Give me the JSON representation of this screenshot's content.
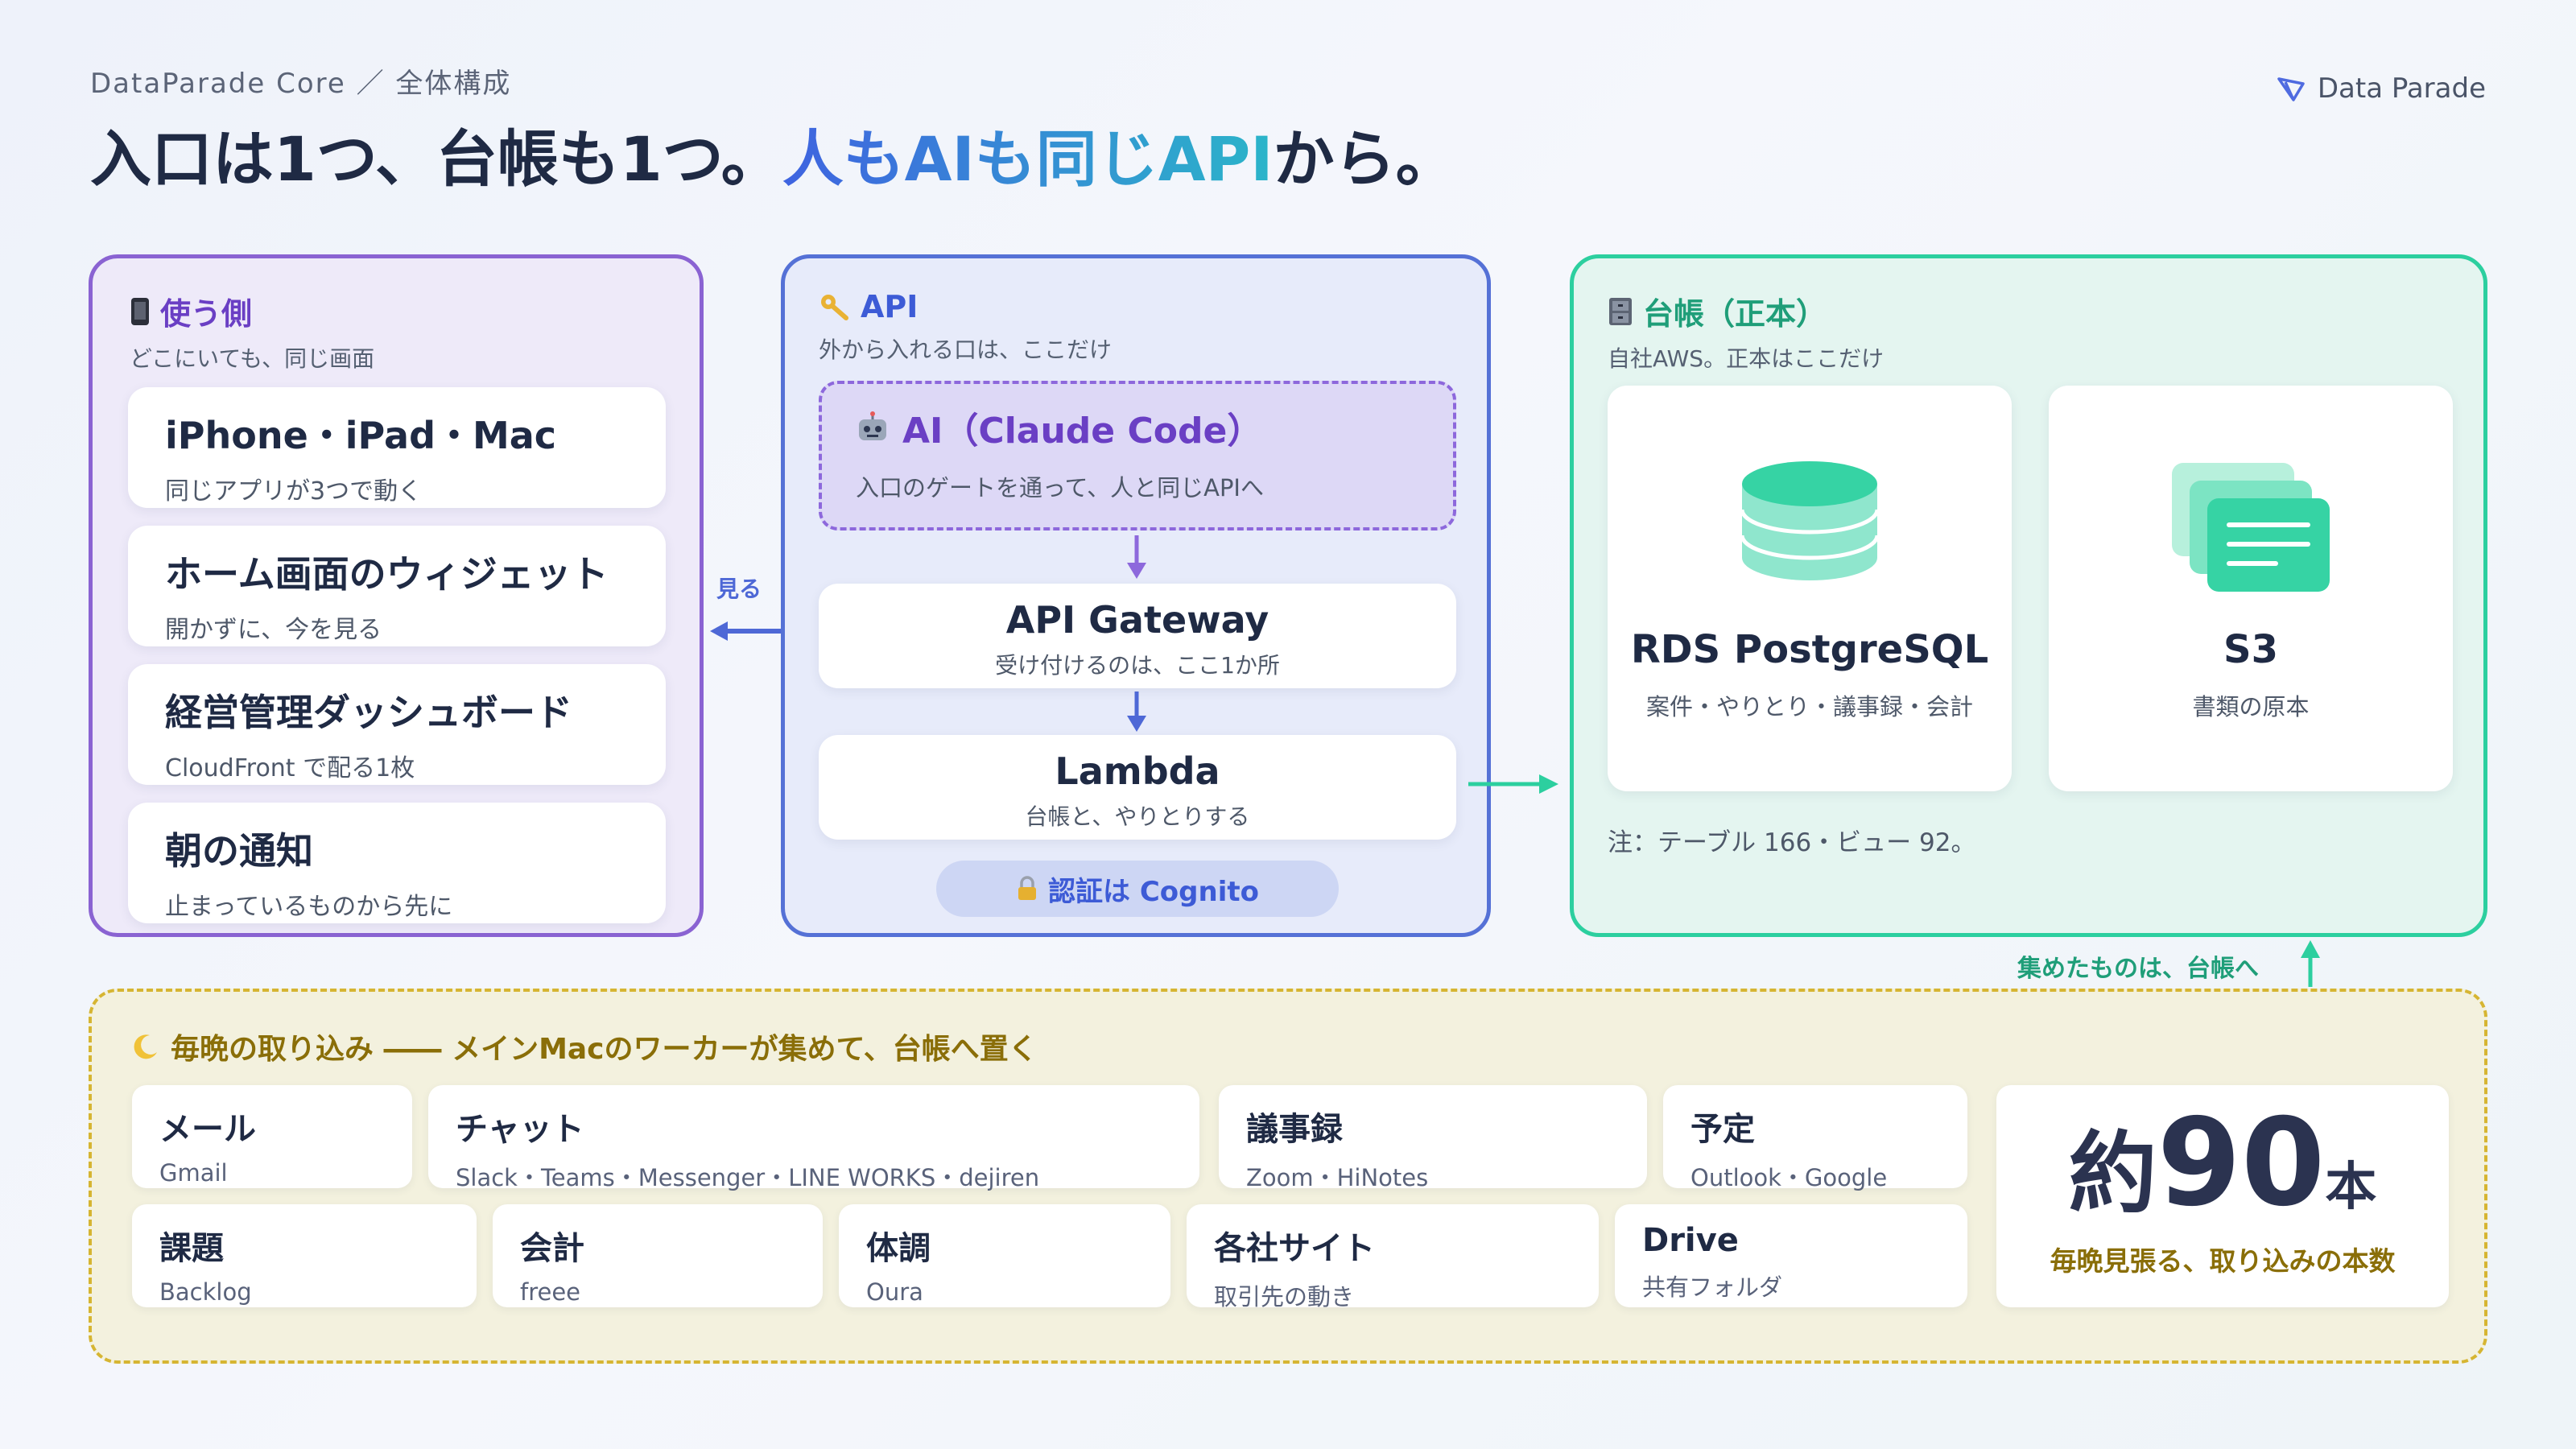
{
  "header": {
    "breadcrumb": "DataParade Core ／ 全体構成",
    "headline_part1": "入口は1つ、台帳も1つ。",
    "headline_highlight": "人もAIも同じAPI",
    "headline_part2": "から。",
    "brand": "Data Parade"
  },
  "users_panel": {
    "title": "使う側",
    "subtitle": "どこにいても、同じ画面",
    "cards": [
      {
        "title": "iPhone・iPad・Mac",
        "sub": "同じアプリが3つで動く"
      },
      {
        "title": "ホーム画面のウィジェット",
        "sub": "開かずに、今を見る"
      },
      {
        "title": "経営管理ダッシュボード",
        "sub": "CloudFront で配る1枚"
      },
      {
        "title": "朝の通知",
        "sub": "止まっているものから先に"
      }
    ],
    "arrow_label": "見る"
  },
  "api_panel": {
    "title": "API",
    "subtitle": "外から入れる口は、ここだけ",
    "ai_title": "AI（Claude Code）",
    "ai_sub": "入口のゲートを通って、人と同じAPIへ",
    "gateway_title": "API Gateway",
    "gateway_sub": "受け付けるのは、ここ1か所",
    "lambda_title": "Lambda",
    "lambda_sub": "台帳と、やりとりする",
    "auth": "認証は Cognito"
  },
  "ledger_panel": {
    "title": "台帳（正本）",
    "subtitle": "自社AWS。正本はここだけ",
    "rds_title": "RDS PostgreSQL",
    "rds_sub": "案件・やりとり・議事録・会計",
    "s3_title": "S3",
    "s3_sub": "書類の原本",
    "note": "注：テーブル 166・ビュー 92。",
    "collect_label": "集めたものは、台帳へ"
  },
  "nightly_panel": {
    "title": "毎晩の取り込み ―― メインMacのワーカーが集めて、台帳へ置く",
    "sources": [
      {
        "title": "メール",
        "sub": "Gmail"
      },
      {
        "title": "チャット",
        "sub": "Slack・Teams・Messenger・LINE WORKS・dejiren"
      },
      {
        "title": "議事録",
        "sub": "Zoom・HiNotes"
      },
      {
        "title": "予定",
        "sub": "Outlook・Google"
      },
      {
        "title": "課題",
        "sub": "Backlog"
      },
      {
        "title": "会計",
        "sub": "freee"
      },
      {
        "title": "体調",
        "sub": "Oura"
      },
      {
        "title": "各社サイト",
        "sub": "取引先の動き"
      },
      {
        "title": "Drive",
        "sub": "共有フォルダ"
      }
    ],
    "count_prefix": "約",
    "count_value": "90",
    "count_unit": "本",
    "count_label": "毎晩見張る、取り込みの本数"
  },
  "colors": {
    "users": "#8a63d2",
    "api": "#5571d6",
    "ledger": "#2ccf9f",
    "nightly": "#d6b532",
    "text": "#1f2a44"
  },
  "icons": [
    "phone-icon",
    "key-icon",
    "cabinet-icon",
    "robot-icon",
    "lock-icon",
    "moon-icon",
    "database-icon",
    "documents-icon",
    "brand-logo-icon"
  ]
}
